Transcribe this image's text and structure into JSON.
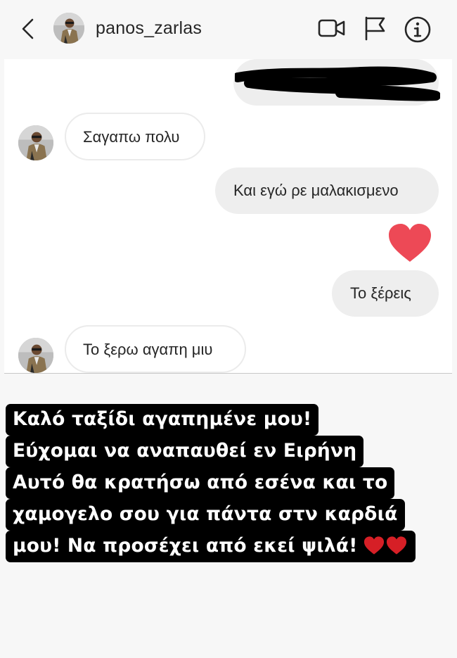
{
  "header": {
    "username": "panos_zarlas",
    "back_icon": "chevron-left-icon",
    "video_icon": "video-call-icon",
    "flag_icon": "flag-icon",
    "info_icon": "info-icon"
  },
  "messages": [
    {
      "side": "outgoing",
      "text": "",
      "redacted": true
    },
    {
      "side": "incoming",
      "text": "Σαγαπω πολυ"
    },
    {
      "side": "outgoing",
      "text": "Και εγώ ρε μαλακισμενο"
    },
    {
      "side": "outgoing",
      "reaction": "red-heart-icon"
    },
    {
      "side": "outgoing",
      "text": "Το ξέρεις"
    },
    {
      "side": "incoming",
      "text": "Το ξερω αγαπη μιυ"
    }
  ],
  "caption": {
    "lines": [
      "Καλό ταξίδι αγαπημένε μου!",
      "Εύχομαι να αναπαυθεί εν Ειρήνη",
      "Αυτό θα κρατήσω από εσένα και το",
      "χαμογελο σου για πάντα στν καρδιά",
      "μου! Να προσέχει από εκεί ψιλά!"
    ],
    "emoji": "red-heart-icon x2"
  },
  "colors": {
    "background": "#f7f7f7",
    "chat_background": "#ffffff",
    "outgoing_bubble": "#eeeeee",
    "heart": "#ed4956",
    "caption_bg": "#000000",
    "caption_text": "#ffffff"
  }
}
